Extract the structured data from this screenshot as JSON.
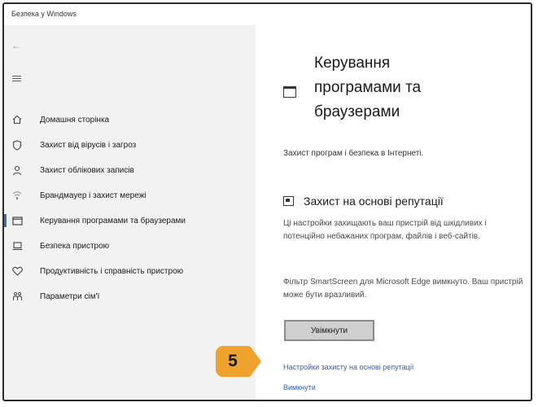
{
  "window": {
    "title": "Безпека у Windows"
  },
  "nav": {
    "back_glyph": "←",
    "items": [
      {
        "label": "Домашня сторінка",
        "icon": "home-icon"
      },
      {
        "label": "Захист від вірусів і загроз",
        "icon": "shield-icon"
      },
      {
        "label": "Захист облікових записів",
        "icon": "person-icon"
      },
      {
        "label": "Брандмауер і захист мережі",
        "icon": "wifi-icon"
      },
      {
        "label": "Керування програмами та браузерами",
        "icon": "app-window-icon",
        "active": true
      },
      {
        "label": "Безпека пристрою",
        "icon": "device-icon"
      },
      {
        "label": "Продуктивність і справність пристрою",
        "icon": "heart-icon"
      },
      {
        "label": "Параметри сім'ї",
        "icon": "family-icon"
      }
    ]
  },
  "main": {
    "title_line1": "Керування",
    "title_line2": "програмами та",
    "title_line3": "браузерами",
    "subtitle": "Захист програм і безпека в Інтернеті.",
    "section": {
      "heading": "Захист на основі репутації",
      "description": "Ці настройки захищають ваш пристрій від шкідливих і потенційно небажаних програм, файлів і веб-сайтів.",
      "warning": "Фільтр SmartScreen для Microsoft Edge вимкнуто. Ваш пристрій може бути вразливий.",
      "button_label": "Увімкнути",
      "link_settings": "Настройки захисту на основі репутації",
      "link_dismiss": "Вимкнути"
    }
  },
  "callout": {
    "number": "5",
    "color": "#f0a22e"
  },
  "colors": {
    "accent": "#2f6fc1",
    "link": "#2f5fb8",
    "sidebar_bg": "#f2f2f2"
  }
}
